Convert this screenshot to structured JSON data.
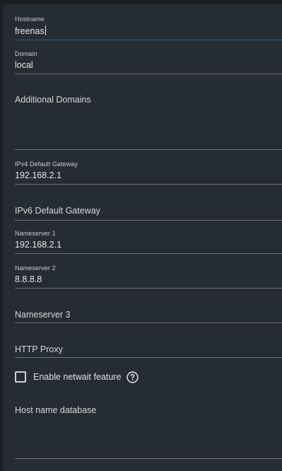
{
  "form": {
    "hostname": {
      "label": "Hostname",
      "value": "freenas"
    },
    "domain": {
      "label": "Domain",
      "value": "local"
    },
    "additional_domains": {
      "placeholder": "Additional Domains"
    },
    "ipv4_gateway": {
      "label": "IPv4 Default Gateway",
      "value": "192.168.2.1"
    },
    "ipv6_gateway": {
      "placeholder": "IPv6 Default Gateway"
    },
    "nameserver1": {
      "label": "Nameserver 1",
      "value": "192.168.2.1"
    },
    "nameserver2": {
      "label": "Nameserver 2",
      "value": "8.8.8.8"
    },
    "nameserver3": {
      "placeholder": "Nameserver 3"
    },
    "http_proxy": {
      "placeholder": "HTTP Proxy"
    },
    "netwait": {
      "label": "Enable netwait feature",
      "checked": false,
      "help_icon": "help-circle-icon"
    },
    "host_name_database": {
      "placeholder": "Host name database"
    }
  },
  "colors": {
    "panel_bg": "#262c33",
    "page_bg": "#1b1f24",
    "underline": "#6b7076",
    "focus_underline": "#2b5f86",
    "text": "#e8e8e8"
  }
}
